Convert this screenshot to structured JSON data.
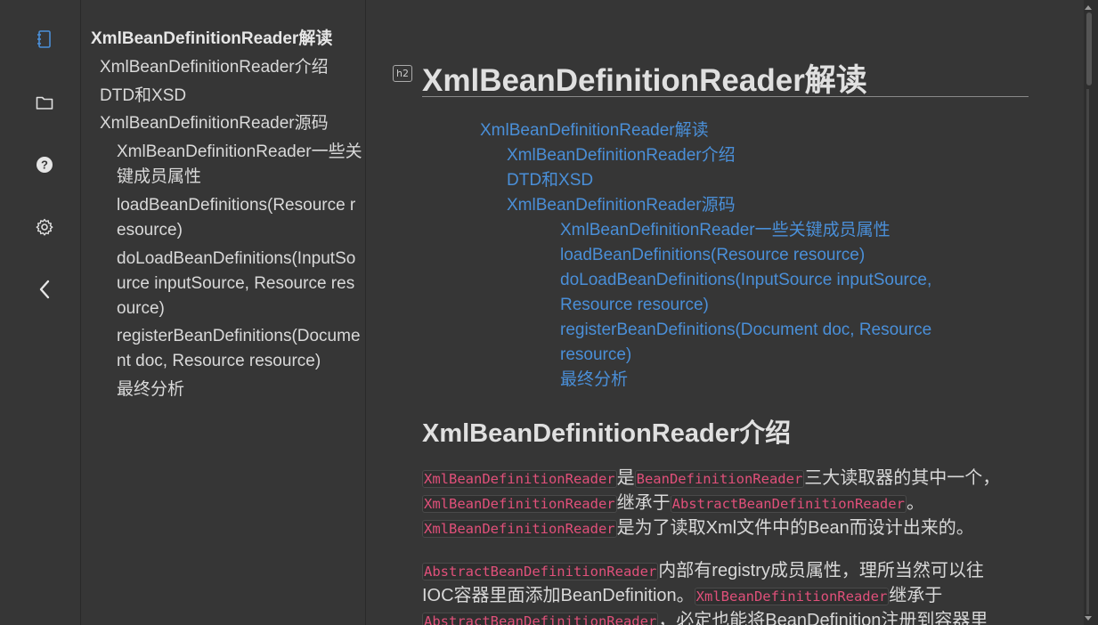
{
  "rail": {
    "icons": [
      "outline-icon",
      "folder-icon",
      "help-icon",
      "settings-icon",
      "collapse-icon"
    ]
  },
  "toc": {
    "items": [
      {
        "label": "XmlBeanDefinitionReader解读",
        "level": 1
      },
      {
        "label": "XmlBeanDefinitionReader介绍",
        "level": 2
      },
      {
        "label": "DTD和XSD",
        "level": 2
      },
      {
        "label": "XmlBeanDefinitionReader源码",
        "level": 2
      },
      {
        "label": "XmlBeanDefinitionReader一些关键成员属性",
        "level": 3
      },
      {
        "label": "loadBeanDefinitions(Resource resource)",
        "level": 3
      },
      {
        "label": "doLoadBeanDefinitions(InputSource inputSource, Resource resource)",
        "level": 3
      },
      {
        "label": "registerBeanDefinitions(Document doc, Resource resource)",
        "level": 3
      },
      {
        "label": "最终分析",
        "level": 3
      }
    ]
  },
  "content": {
    "badge": "h2",
    "title": "XmlBeanDefinitionReader解读",
    "toc_links": [
      "XmlBeanDefinitionReader解读",
      "XmlBeanDefinitionReader介绍",
      "DTD和XSD",
      "XmlBeanDefinitionReader源码",
      "XmlBeanDefinitionReader一些关键成员属性",
      "loadBeanDefinitions(Resource resource)",
      "doLoadBeanDefinitions(InputSource inputSource,",
      "Resource resource)",
      "registerBeanDefinitions(Document doc, Resource",
      "resource)",
      "最终分析"
    ],
    "section_title": "XmlBeanDefinitionReader介绍",
    "p1": {
      "c1": "XmlBeanDefinitionReader",
      "t1": "是",
      "c2": "BeanDefinitionReader",
      "t2": "三大读取器的其中一个，",
      "c3": "XmlBeanDefinitionReader",
      "t3": "继承于",
      "c4": "AbstractBeanDefinitionReader",
      "t4": "。",
      "c5": "XmlBeanDefinitionReader",
      "t5": "是为了读取Xml文件中的Bean而设计出来的。"
    },
    "p2": {
      "c1": "AbstractBeanDefinitionReader",
      "t1": "内部有registry成员属性，理所当然可以往",
      "t2": "IOC容器里面添加BeanDefinition。",
      "c2": "XmlBeanDefinitionReader",
      "t3": "继承于",
      "c3": "AbstractBeanDefinitionReader",
      "t4": "，必定也能将BeanDefinition注册到容器里"
    }
  }
}
